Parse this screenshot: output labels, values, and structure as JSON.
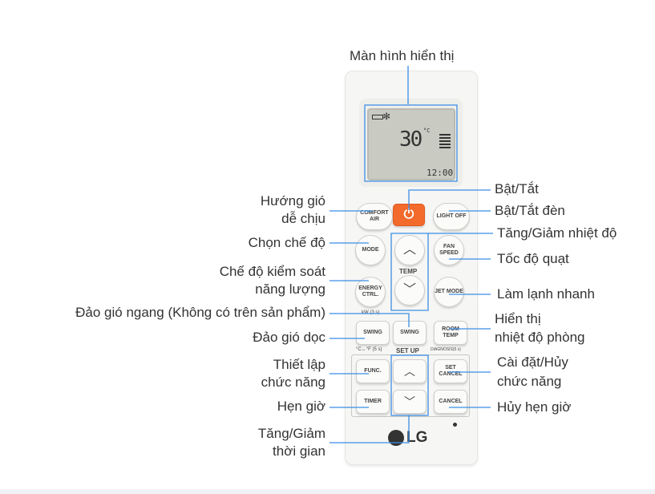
{
  "accent_color": "#3a8ee6",
  "labels": {
    "display": "Màn hình hiển thị",
    "power": "Bật/Tắt",
    "light": "Bật/Tắt đèn",
    "temp": "Tăng/Giảm nhiệt độ",
    "fan": "Tốc độ quạt",
    "jet": "Làm lạnh nhanh",
    "room_temp_1": "Hiển thị",
    "room_temp_2": "nhiệt độ phòng",
    "set_cancel_1": "Cài đặt/Hủy",
    "set_cancel_2": "chức năng",
    "cancel_timer": "Hủy hẹn giờ",
    "comfort_1": "Hướng gió",
    "comfort_2": "dễ chịu",
    "mode": "Chọn chế độ",
    "energy_1": "Chế độ kiểm soát",
    "energy_2": "năng lượng",
    "h_swing": "Đảo gió ngang (Không có trên sản phẩm)",
    "v_swing": "Đảo gió dọc",
    "func_1": "Thiết lập",
    "func_2": "chức năng",
    "timer": "Hẹn giờ",
    "time_1": "Tăng/Giảm",
    "time_2": "thời gian"
  },
  "remote": {
    "lcd_temp": "30",
    "lcd_unit": "°C",
    "lcd_time": "12:00",
    "buttons": {
      "comfort": "COMFORT AIR",
      "light": "LIGHT OFF",
      "mode": "MODE",
      "fan": "FAN SPEED",
      "temp": "TEMP",
      "energy": "ENERGY CTRL.",
      "jet": "JET MODE",
      "swing_v": "SWING",
      "swing_h": "SWING",
      "room": "ROOM TEMP",
      "func": "FUNC.",
      "set": "SET CANCEL",
      "timer": "TIMER",
      "cancel": "CANCEL"
    },
    "kw": "kW (3 s)",
    "cf": "°C↔°F (5 s)",
    "diag": "DIAGNOSIS(5 s)",
    "setup": "SET UP",
    "logo": "LG"
  }
}
